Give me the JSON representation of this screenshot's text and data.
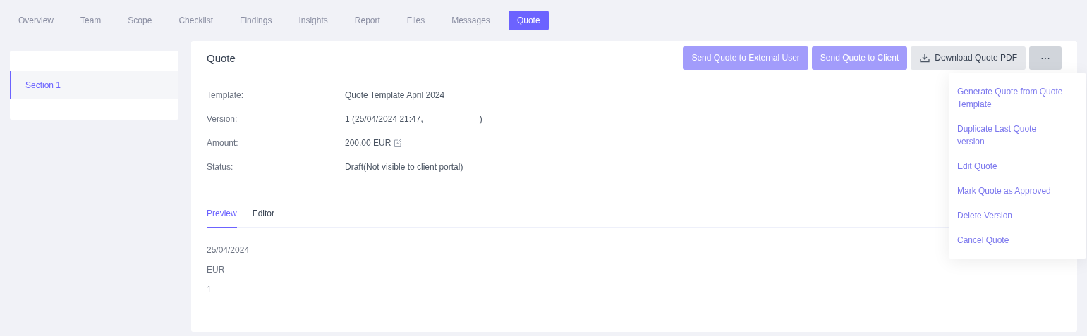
{
  "tabs": [
    {
      "label": "Overview",
      "selected": false
    },
    {
      "label": "Team",
      "selected": false
    },
    {
      "label": "Scope",
      "selected": false
    },
    {
      "label": "Checklist",
      "selected": false
    },
    {
      "label": "Findings",
      "selected": false
    },
    {
      "label": "Insights",
      "selected": false
    },
    {
      "label": "Report",
      "selected": false
    },
    {
      "label": "Files",
      "selected": false
    },
    {
      "label": "Messages",
      "selected": false
    },
    {
      "label": "Quote",
      "selected": true
    }
  ],
  "sidebar": {
    "items": [
      {
        "label": "Section 1",
        "selected": true
      }
    ]
  },
  "card": {
    "title": "Quote",
    "actions": [
      {
        "label": "Send Quote to External User",
        "kind": "primary"
      },
      {
        "label": "Send Quote to Client",
        "kind": "primary"
      },
      {
        "label": "Download Quote PDF",
        "kind": "download"
      },
      {
        "label": "···",
        "kind": "more"
      }
    ],
    "fields": [
      {
        "label": "Template:",
        "value": "Quote Template April 2024"
      },
      {
        "label": "Version:",
        "value": "1 (25/04/2024 21:47,",
        "value_end": ")"
      },
      {
        "label": "Amount:",
        "value": "200.00 EUR",
        "editable": true
      },
      {
        "label": "Status:",
        "value": "Draft(Not visible to client portal)"
      }
    ],
    "view_tabs": [
      {
        "label": "Preview",
        "selected": true
      },
      {
        "label": "Editor",
        "selected": false
      }
    ],
    "preview_lines": [
      "25/04/2024",
      "EUR",
      "1"
    ]
  },
  "menu": {
    "items": [
      "Generate Quote from Quote Template",
      "Duplicate Last Quote version",
      "Edit Quote",
      "Mark Quote as Approved",
      "Delete Version",
      "Cancel Quote"
    ]
  }
}
